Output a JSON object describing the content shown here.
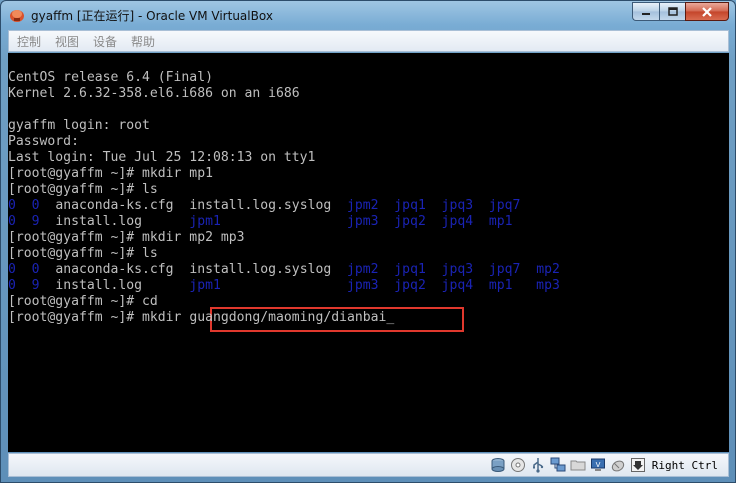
{
  "window": {
    "title": "gyaffm [正在运行] - Oracle VM VirtualBox"
  },
  "menu": {
    "items": [
      "控制",
      "视图",
      "设备",
      "帮助"
    ]
  },
  "console": {
    "lines": [
      [
        {
          "t": "CentOS release 6.4 (Final)"
        }
      ],
      [
        {
          "t": "Kernel 2.6.32-358.el6.i686 on an i686"
        }
      ],
      [
        {
          "t": ""
        }
      ],
      [
        {
          "t": "gyaffm login: root"
        }
      ],
      [
        {
          "t": "Password:"
        }
      ],
      [
        {
          "t": "Last login: Tue Jul 25 12:08:13 on tty1"
        }
      ],
      [
        {
          "t": "[root@gyaffm ~]# mkdir mp1"
        }
      ],
      [
        {
          "t": "[root@gyaffm ~]# ls"
        }
      ],
      [
        {
          "t": "0  0  ",
          "c": "blue"
        },
        {
          "t": "anaconda-ks.cfg  install.log.syslog  "
        },
        {
          "t": "jpm2  jpq1  jpq3  jpq7",
          "c": "blue"
        }
      ],
      [
        {
          "t": "0  9  ",
          "c": "blue"
        },
        {
          "t": "install.log      "
        },
        {
          "t": "jpm1                jpm3  jpq2  jpq4  mp1",
          "c": "blue"
        }
      ],
      [
        {
          "t": "[root@gyaffm ~]# mkdir mp2 mp3"
        }
      ],
      [
        {
          "t": "[root@gyaffm ~]# ls"
        }
      ],
      [
        {
          "t": "0  0  ",
          "c": "blue"
        },
        {
          "t": "anaconda-ks.cfg  install.log.syslog  "
        },
        {
          "t": "jpm2  jpq1  jpq3  jpq7  mp2",
          "c": "blue"
        }
      ],
      [
        {
          "t": "0  9  ",
          "c": "blue"
        },
        {
          "t": "install.log      "
        },
        {
          "t": "jpm1                jpm3  jpq2  jpq4  mp1   mp3",
          "c": "blue"
        }
      ],
      [
        {
          "t": "[root@gyaffm ~]# cd"
        }
      ],
      [
        {
          "t": "[root@gyaffm ~]# mkdir "
        },
        {
          "t": "guangdong/maoming/dianbai_"
        }
      ]
    ]
  },
  "statusbar": {
    "host_key": "Right Ctrl",
    "icons": [
      "hard-disk-icon",
      "optical-drive-icon",
      "usb-icon",
      "network-icon",
      "shared-folder-icon",
      "display-icon",
      "mouse-integration-icon",
      "host-key-icon"
    ]
  },
  "colors": {
    "console_text": "#bfbfbf",
    "console_blue": "#1a23b4",
    "highlight_box": "#e0382d"
  }
}
